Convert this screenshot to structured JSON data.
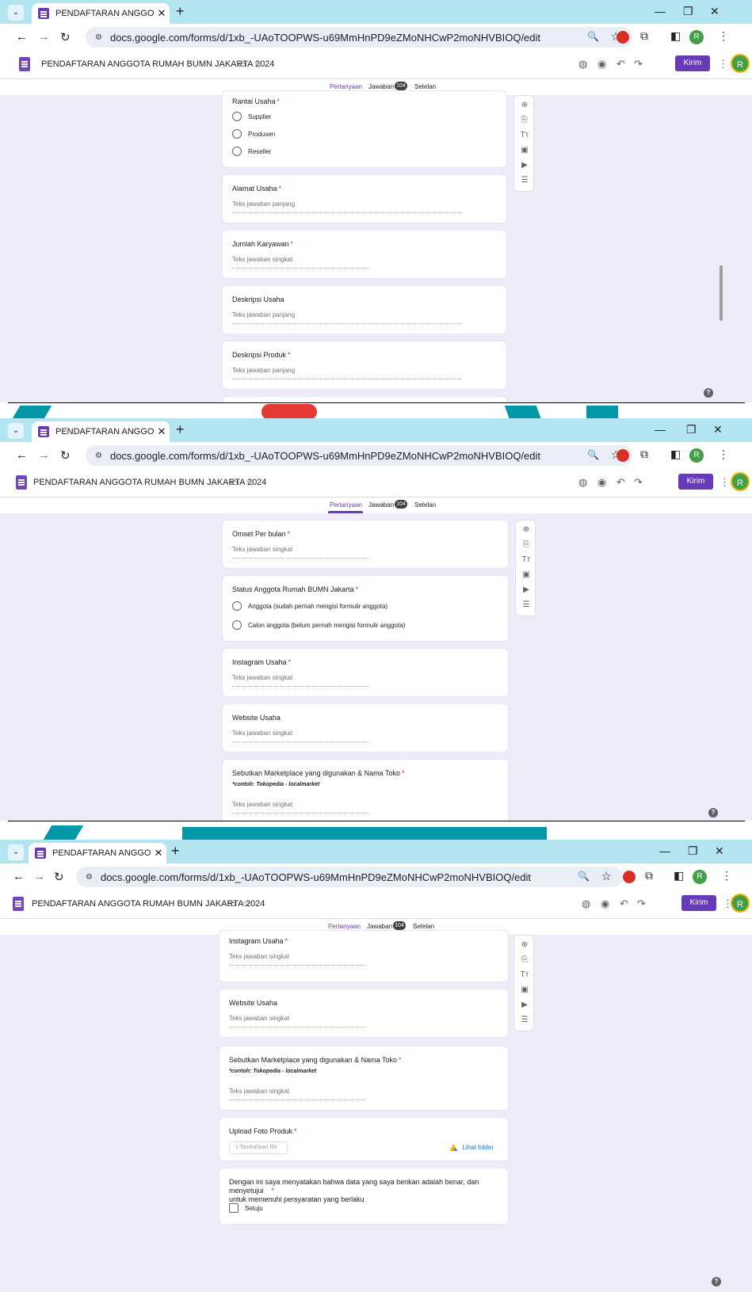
{
  "browser": {
    "tab_title": "PENDAFTARAN ANGGOTA RUM/",
    "url": "docs.google.com/forms/d/1xb_-UAoTOOPWS-u69MmHnPD9eZMoNHCwP2moNHVBIOQ/edit",
    "tab_close": "✕",
    "new_tab": "+",
    "avatar_letter": "R"
  },
  "form_header": {
    "title": "PENDAFTARAN ANGGOTA RUMAH BUMN JAKARTA 2024",
    "send_label": "Kirim",
    "avatar_letter": "R"
  },
  "tabs": {
    "questions": "Pertanyaan",
    "responses": "Jawaban",
    "responses_count": "104",
    "settings": "Setelan"
  },
  "help_label": "?",
  "toolbar_icons": [
    "add-question-icon",
    "import-questions-icon",
    "title-text-icon",
    "image-icon",
    "video-icon",
    "section-icon"
  ],
  "hints": {
    "long": "Teks jawaban panjang",
    "short": "Teks jawaban singkat"
  },
  "panel1": {
    "rantai": {
      "question": "Rantai Usaha",
      "options": [
        "Supplier",
        "Produsen",
        "Reseller"
      ]
    },
    "alamat": {
      "question": "Alamat Usaha"
    },
    "karyawan": {
      "question": "Jumlah Karyawan"
    },
    "deskripsi_usaha": {
      "question": "Deskripsi Usaha"
    },
    "deskripsi_produk": {
      "question": "Deskripsi Produk"
    }
  },
  "panel2": {
    "omset": {
      "question": "Omset Per bulan"
    },
    "status": {
      "question": "Status Anggota Rumah BUMN Jakarta",
      "options": [
        "Anggota (sudah pernah mengisi formulir anggota)",
        "Calon anggota (belum pernah mengisi formulir anggota)"
      ]
    },
    "instagram": {
      "question": "Instagram Usaha"
    },
    "website": {
      "question": "Website Usaha"
    },
    "marketplace": {
      "question": "Sebutkan Marketplace yang digunakan & Nama Toko",
      "description": "*contoh: Tokopedia - localmarket"
    }
  },
  "panel3": {
    "instagram": {
      "question": "Instagram Usaha"
    },
    "website": {
      "question": "Website Usaha"
    },
    "marketplace": {
      "question": "Sebutkan Marketplace yang digunakan & Nama Toko",
      "description": "*contoh: Tokopedia - localmarket"
    },
    "upload": {
      "question": "Upload Foto Produk",
      "add_file": "Tambahkan file",
      "view_folder": "Lihat folder"
    },
    "agreement": {
      "question_line1": "Dengan ini saya menyatakan bahwa data yang saya berikan adalah benar, dan menyetujui",
      "question_line2": "untuk memenuhi persyaratan yang berlaku",
      "option": "Setuju"
    }
  }
}
